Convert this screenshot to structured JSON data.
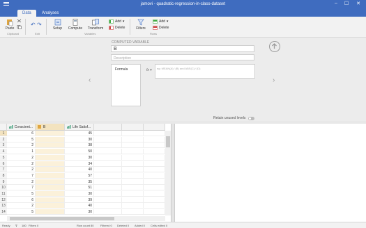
{
  "window": {
    "title": "jamovi - quadratic-regression-in-class-dataset",
    "min": "–",
    "max": "☐",
    "close": "✕"
  },
  "tabs": [
    "Data",
    "Analyses"
  ],
  "ribbon": {
    "paste": "Paste",
    "clipboard": "Clipboard",
    "edit": "Edit",
    "setup": "Setup",
    "compute": "Compute",
    "transform": "Transform",
    "variables": "Variables",
    "add": "Add",
    "delete": "Delete",
    "filters": "Filters",
    "add2": "Add",
    "delete2": "Delete",
    "rows": "Rows"
  },
  "editor": {
    "header": "COMPUTED VARIABLE",
    "name": "B",
    "description_placeholder": "Description",
    "formula_item": "Formula",
    "fx": "fx",
    "formula_placeholder": "eg: MEAN(A) ⁄ (B) and ABS(C) ⁄ (D)",
    "retain": "Retain unused levels"
  },
  "sheet": {
    "columns": [
      "Conscient...",
      "B",
      "Life Satisf..."
    ],
    "rows": [
      {
        "n": "1",
        "a": "6",
        "c": "45"
      },
      {
        "n": "2",
        "a": "5",
        "c": "30"
      },
      {
        "n": "3",
        "a": "2",
        "c": "38"
      },
      {
        "n": "4",
        "a": "1",
        "c": "50"
      },
      {
        "n": "5",
        "a": "2",
        "c": "30"
      },
      {
        "n": "6",
        "a": "2",
        "c": "34"
      },
      {
        "n": "7",
        "a": "2",
        "c": "40"
      },
      {
        "n": "8",
        "a": "7",
        "c": "57"
      },
      {
        "n": "9",
        "a": "2",
        "c": "35"
      },
      {
        "n": "10",
        "a": "7",
        "c": "51"
      },
      {
        "n": "11",
        "a": "5",
        "c": "30"
      },
      {
        "n": "12",
        "a": "6",
        "c": "39"
      },
      {
        "n": "13",
        "a": "2",
        "c": "40"
      },
      {
        "n": "14",
        "a": "5",
        "c": "30"
      }
    ]
  },
  "status": {
    "ready": "Ready",
    "filter_count": "180",
    "filters": "Filters 0",
    "row_count": "Row count 80",
    "filtered": "Filtered 0",
    "deleted": "Deleted 0",
    "added": "Added 0",
    "cells_edited": "Cells edited 0"
  },
  "colors": {
    "brand": "#3f6cbf",
    "selected_col": "#f3e3bf"
  }
}
